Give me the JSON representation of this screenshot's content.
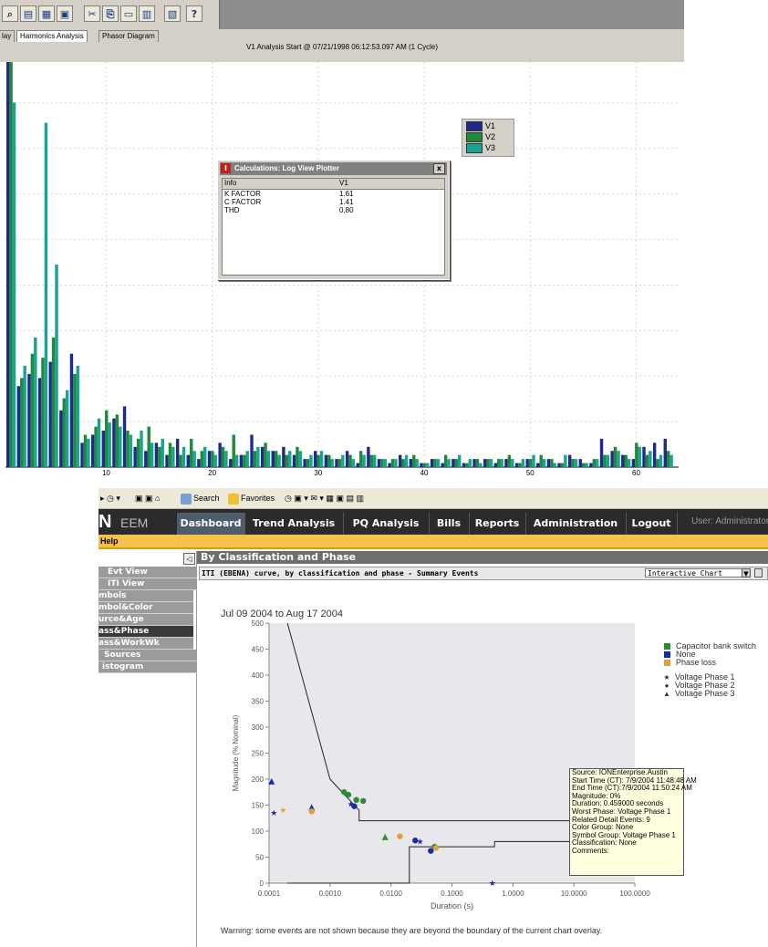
{
  "upper": {
    "tabs": [
      "lay",
      "Harmonics Analysis",
      "Phasor Diagram"
    ],
    "header": "V1 Analysis Start @ 07/21/1998 06:12:53.097 AM (1 Cycle)",
    "legend": [
      {
        "label": "V1",
        "color": "#1f2a8a"
      },
      {
        "label": "V2",
        "color": "#1e8a3a"
      },
      {
        "label": "V3",
        "color": "#1aa393"
      }
    ],
    "calc_window": {
      "title": "Calculations: Log View Plotter",
      "close": "x",
      "columns": [
        "Info",
        "V1"
      ],
      "rows": [
        {
          "info": "K FACTOR",
          "v1": "1.61"
        },
        {
          "info": "C FACTOR",
          "v1": "1.41"
        },
        {
          "info": "THD",
          "v1": "0.80"
        }
      ]
    },
    "x_ticks": [
      "10",
      "20",
      "30",
      "40",
      "50",
      "60"
    ]
  },
  "lower": {
    "ie_toolbar": {
      "search": "Search",
      "favorites": "Favorites"
    },
    "nav": {
      "logo": "N",
      "product": "EEM",
      "tabs": [
        "Dashboard",
        "Trend Analysis",
        "PQ Analysis",
        "Bills",
        "Reports",
        "Administration",
        "Logout"
      ],
      "active_tab": "Dashboard",
      "user": "User: Administrator A"
    },
    "help": "Help",
    "sidebar": {
      "collapse": "◁",
      "items": [
        "Evt View",
        "ITI View",
        "mbols",
        "mbol&Color",
        "urce&Age",
        "ass&Phase",
        "ass&WorkWk",
        "Sources",
        "istogram"
      ],
      "active_index": 5
    },
    "page_title": "By Classification and Phase",
    "subtitle": "ITI (EBENA) curve, by classification and phase - Summary Events",
    "chart_select": "Interactive Chart",
    "date_range": "Jul 09 2004 to Aug 17 2004",
    "tooltip": [
      "Source: IONEnterprise.Austin",
      "Start Time (CT): 7/9/2004 11:48:48 AM",
      "End Time (CT):7/9/2004 11:50:24 AM",
      "Magnitude: 0%",
      "Duration: 0.459000 seconds",
      "Worst Phase: Voltage Phase 1",
      "Related Detail Events: 9",
      "Color Group: None",
      "Symbol Group: Voltage Phase 1",
      "Classification: None",
      "Comments:"
    ],
    "legend": {
      "colors": [
        {
          "label": "Capacitor bank switch",
          "color": "#2e8b2e"
        },
        {
          "label": "None",
          "color": "#1a2aa8"
        },
        {
          "label": "Phase loss",
          "color": "#e0a040"
        }
      ],
      "symbols": [
        {
          "label": "Voltage Phase 1",
          "symbol": "★"
        },
        {
          "label": "Voltage Phase 2",
          "symbol": "●"
        },
        {
          "label": "Voltage Phase 3",
          "symbol": "▲"
        }
      ]
    },
    "warning": "Warning: some events are not shown because they are beyond the boundary of the current chart overlay."
  },
  "chart_data": [
    {
      "type": "bar",
      "title": "",
      "categories": [
        1,
        2,
        3,
        4,
        5,
        6,
        7,
        8,
        9,
        10,
        11,
        12,
        13,
        14,
        15,
        16,
        17,
        18,
        19,
        20,
        21,
        22,
        23,
        24,
        25,
        26,
        27,
        28,
        29,
        30,
        31,
        32,
        33,
        34,
        35,
        36,
        37,
        38,
        39,
        40,
        41,
        42,
        43,
        44,
        45,
        46,
        47,
        48,
        49,
        50,
        51,
        52,
        53,
        54,
        55,
        56,
        57,
        58,
        59,
        60,
        61,
        62,
        63
      ],
      "ylim": [
        0,
        100
      ],
      "series": [
        {
          "name": "V1",
          "values": [
            100,
            20,
            23,
            22,
            26,
            14,
            28,
            6,
            8,
            9,
            12,
            15,
            5,
            4,
            6,
            3,
            7,
            3,
            2,
            4,
            6,
            2,
            3,
            8,
            5,
            4,
            5,
            3,
            2,
            4,
            3,
            2,
            4,
            1,
            5,
            2,
            1,
            3,
            2,
            1,
            2,
            1,
            2,
            1,
            2,
            2,
            1,
            2,
            1,
            2,
            1,
            2,
            1,
            3,
            2,
            1,
            7,
            4,
            3,
            2,
            5,
            6,
            7
          ]
        },
        {
          "name": "V2",
          "values": [
            100,
            22,
            28,
            27,
            32,
            17,
            23,
            8,
            10,
            14,
            13,
            9,
            7,
            10,
            5,
            6,
            3,
            7,
            4,
            4,
            5,
            8,
            3,
            4,
            6,
            4,
            3,
            5,
            2,
            3,
            3,
            2,
            3,
            4,
            3,
            2,
            2,
            2,
            3,
            1,
            2,
            3,
            2,
            1,
            2,
            2,
            2,
            3,
            1,
            2,
            3,
            2,
            1,
            2,
            1,
            2,
            3,
            5,
            3,
            6,
            3,
            2,
            4
          ]
        },
        {
          "name": "V3",
          "values": [
            90,
            25,
            32,
            85,
            50,
            19,
            25,
            7,
            12,
            11,
            10,
            8,
            9,
            6,
            7,
            5,
            5,
            4,
            5,
            3,
            4,
            3,
            4,
            5,
            4,
            3,
            4,
            4,
            3,
            4,
            2,
            3,
            2,
            3,
            3,
            2,
            2,
            3,
            2,
            1,
            2,
            2,
            3,
            2,
            1,
            2,
            2,
            2,
            2,
            3,
            2,
            1,
            3,
            2,
            1,
            2,
            3,
            4,
            2,
            5,
            4,
            3,
            3
          ]
        }
      ]
    },
    {
      "type": "scatter",
      "title": "ITI (EBENA) curve, by classification and phase - Summary Events",
      "xlabel": "Duration (s)",
      "ylabel": "Magnitude (% Nominal)",
      "x_scale": "log",
      "xlim": [
        0.0001,
        100
      ],
      "ylim": [
        0,
        500
      ],
      "x_ticks": [
        "0.0001",
        "0.0010",
        "0.0100",
        "0.1000",
        "1.0000",
        "10.0000",
        "100.0000"
      ],
      "y_ticks": [
        0,
        50,
        100,
        150,
        200,
        250,
        300,
        350,
        400,
        450,
        500
      ],
      "upper_curve": [
        [
          0.0002,
          500
        ],
        [
          0.001,
          200
        ],
        [
          0.003,
          140
        ],
        [
          0.003,
          120
        ],
        [
          0.5,
          120
        ],
        [
          0.5,
          120
        ],
        [
          10,
          120
        ]
      ],
      "lower_curve": [
        [
          0.0002,
          0
        ],
        [
          0.02,
          0
        ],
        [
          0.02,
          70
        ],
        [
          0.5,
          70
        ],
        [
          0.5,
          80
        ],
        [
          10,
          80
        ]
      ],
      "points": [
        {
          "x": 0.00011,
          "y": 195,
          "class": "None",
          "phase": "Voltage Phase 3"
        },
        {
          "x": 0.00012,
          "y": 135,
          "class": "None",
          "phase": "Voltage Phase 1"
        },
        {
          "x": 0.00017,
          "y": 140,
          "class": "Phase loss",
          "phase": "Voltage Phase 1"
        },
        {
          "x": 0.0005,
          "y": 145,
          "class": "None",
          "phase": "Voltage Phase 3"
        },
        {
          "x": 0.0005,
          "y": 138,
          "class": "Phase loss",
          "phase": "Voltage Phase 2"
        },
        {
          "x": 0.0017,
          "y": 175,
          "class": "Capacitor bank switch",
          "phase": "Voltage Phase 2"
        },
        {
          "x": 0.002,
          "y": 170,
          "class": "Capacitor bank switch",
          "phase": "Voltage Phase 2"
        },
        {
          "x": 0.0022,
          "y": 152,
          "class": "None",
          "phase": "Voltage Phase 1"
        },
        {
          "x": 0.0025,
          "y": 148,
          "class": "None",
          "phase": "Voltage Phase 2"
        },
        {
          "x": 0.0027,
          "y": 160,
          "class": "Capacitor bank switch",
          "phase": "Voltage Phase 2"
        },
        {
          "x": 0.0035,
          "y": 158,
          "class": "Capacitor bank switch",
          "phase": "Voltage Phase 2"
        },
        {
          "x": 0.008,
          "y": 88,
          "class": "Capacitor bank switch",
          "phase": "Voltage Phase 3"
        },
        {
          "x": 0.014,
          "y": 90,
          "class": "Phase loss",
          "phase": "Voltage Phase 2"
        },
        {
          "x": 0.025,
          "y": 82,
          "class": "None",
          "phase": "Voltage Phase 2"
        },
        {
          "x": 0.03,
          "y": 80,
          "class": "None",
          "phase": "Voltage Phase 1"
        },
        {
          "x": 0.045,
          "y": 62,
          "class": "None",
          "phase": "Voltage Phase 2"
        },
        {
          "x": 0.052,
          "y": 70,
          "class": "Capacitor bank switch",
          "phase": "Voltage Phase 2"
        },
        {
          "x": 0.055,
          "y": 68,
          "class": "Phase loss",
          "phase": "Voltage Phase 2"
        },
        {
          "x": 0.459,
          "y": 0,
          "class": "None",
          "phase": "Voltage Phase 1"
        }
      ]
    }
  ]
}
